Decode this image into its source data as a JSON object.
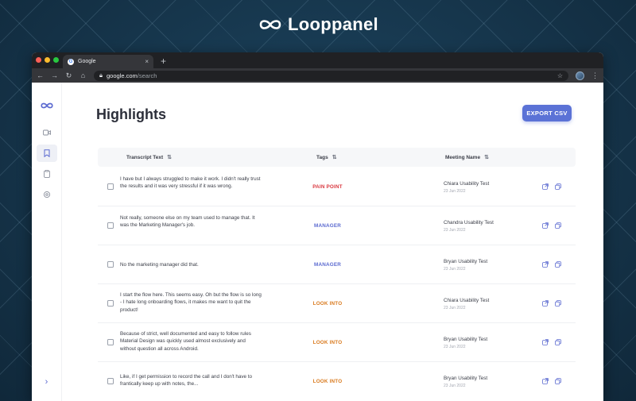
{
  "brand": {
    "name": "Looppanel"
  },
  "browser": {
    "tab_title": "Google",
    "tab_close": "×",
    "new_tab": "+",
    "url_host": "google.com",
    "url_path": "/search"
  },
  "page": {
    "title": "Highlights",
    "export_label": "EXPORT CSV"
  },
  "table": {
    "headers": {
      "transcript": "Transcript Text",
      "tags": "Tags",
      "meeting": "Meeting Name"
    },
    "rows": [
      {
        "text": "I have but I always struggled to make it work. I didn't really trust the results and it was very stressful if it was wrong.",
        "tag": "PAIN POINT",
        "tag_color": "#d9363e",
        "meeting": "Chiara Usability Test",
        "date": "23 Jun 2022"
      },
      {
        "text": "Not really, someone else on my team used to manage that. It was the Marketing Manager's job.",
        "tag": "MANAGER",
        "tag_color": "#5b6ad0",
        "meeting": "Chandra Usability Test",
        "date": "23 Jun 2022"
      },
      {
        "text": "No the marketing manager did that.",
        "tag": "MANAGER",
        "tag_color": "#5b6ad0",
        "meeting": "Bryan Usability Test",
        "date": "23 Jun 2022"
      },
      {
        "text": "I start the flow here. This seems easy. Oh but the flow is so long - I hate long onboarding flows, it makes me want to quit the product!",
        "tag": "LOOK INTO",
        "tag_color": "#d97a1e",
        "meeting": "Chiara Usability Test",
        "date": "23 Jun 2022"
      },
      {
        "text": "Because of strict, well documented and easy to follow rules Material Design was quickly used almost exclusively and without question all across Android.",
        "tag": "LOOK INTO",
        "tag_color": "#d97a1e",
        "meeting": "Bryan Usability Test",
        "date": "23 Jun 2022"
      },
      {
        "text": "Like, if I get permission to record the call and I don't have to frantically keep up with notes, the...",
        "tag": "LOOK INTO",
        "tag_color": "#d97a1e",
        "meeting": "Bryan Usability Test",
        "date": "23 Jun 2022"
      }
    ]
  },
  "sidebar": {
    "items": [
      "logo-icon",
      "video-icon",
      "bookmark-icon",
      "clipboard-icon",
      "settings-icon"
    ],
    "expand": "›"
  },
  "colors": {
    "accent": "#5b72d6",
    "pain_point": "#d9363e",
    "manager": "#5b6ad0",
    "look_into": "#d97a1e"
  }
}
